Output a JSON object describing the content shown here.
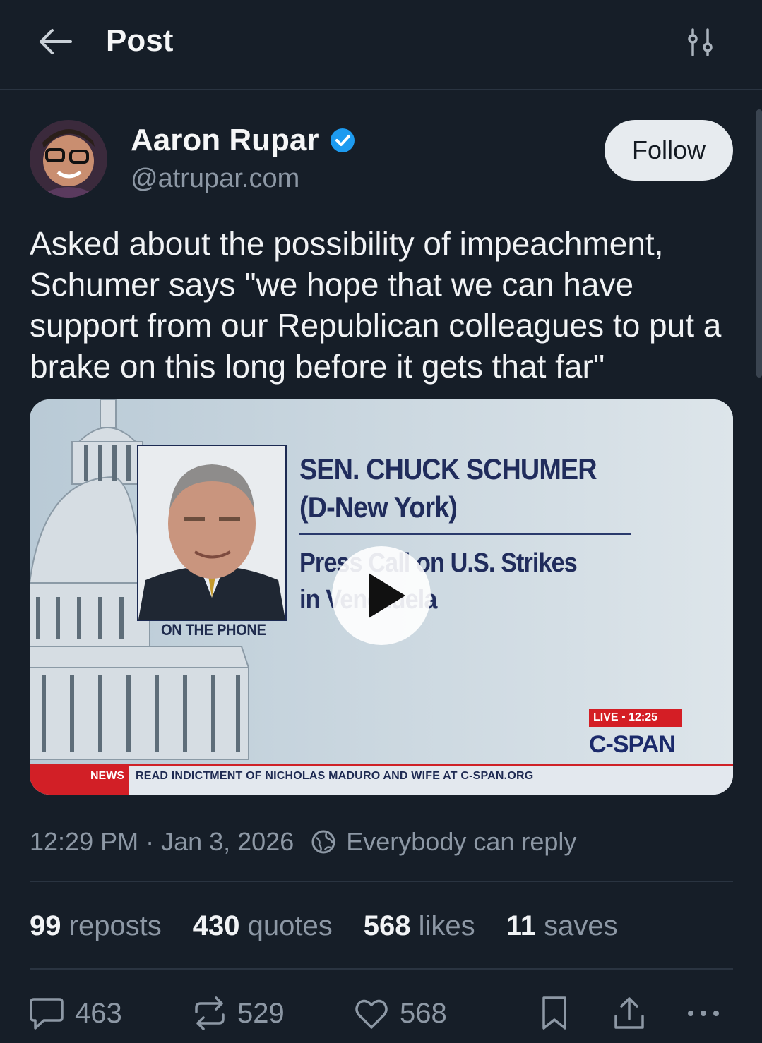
{
  "header": {
    "title": "Post"
  },
  "author": {
    "name": "Aaron Rupar",
    "handle": "@atrupar.com",
    "follow_label": "Follow"
  },
  "post": {
    "text": "Asked about the possibility of impeachment, Schumer says \"we hope that we can have support from our Republican colleagues to put a brake on this long before it gets that far\"",
    "timestamp": "12:29 PM · Jan 3, 2026",
    "reply_setting": "Everybody can reply"
  },
  "media": {
    "name_line1": "SEN. CHUCK SCHUMER",
    "name_line2": "(D-New York)",
    "event_line1": "Press Call on U.S. Strikes",
    "event_line2": "in Venezuela",
    "on_phone": "ON THE PHONE",
    "live_badge": "LIVE ▪ 12:25",
    "network": "C-SPAN",
    "ticker_tag": "NEWS",
    "ticker_text": "READ INDICTMENT OF NICHOLAS MADURO AND WIFE AT C-SPAN.ORG"
  },
  "stats": {
    "reposts_count": "99",
    "reposts_label": "reposts",
    "quotes_count": "430",
    "quotes_label": "quotes",
    "likes_count": "568",
    "likes_label": "likes",
    "saves_count": "11",
    "saves_label": "saves"
  },
  "actions": {
    "replies": "463",
    "reposts": "529",
    "likes": "568"
  },
  "colors": {
    "background": "#161e28",
    "accent": "#1d9bf0",
    "muted": "#8d98a5"
  }
}
